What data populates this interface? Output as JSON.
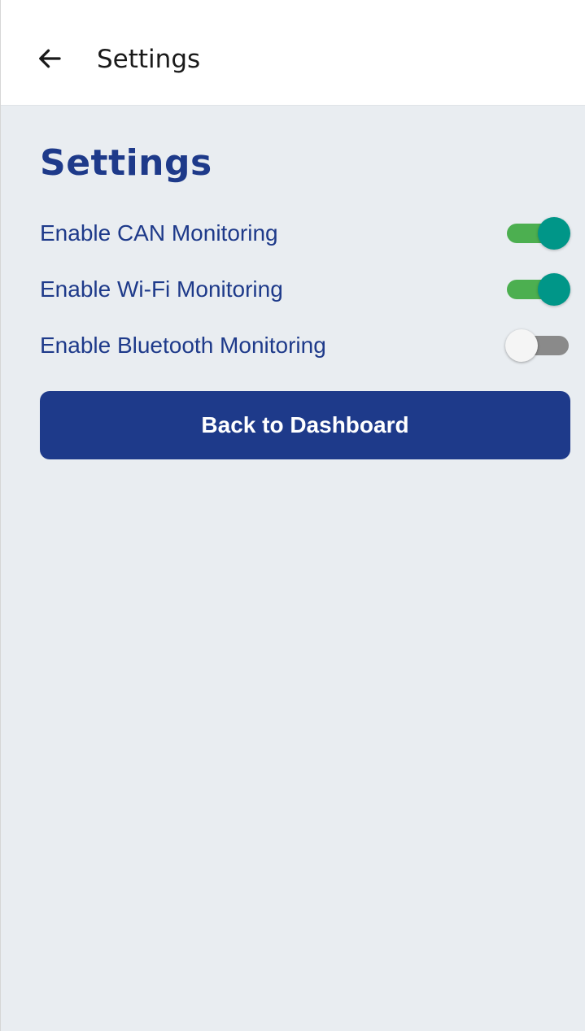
{
  "app_bar": {
    "back_icon": "arrow-left-icon",
    "title": "Settings"
  },
  "main": {
    "title": "Settings",
    "settings": [
      {
        "label": "Enable CAN Monitoring",
        "enabled": true
      },
      {
        "label": "Enable Wi-Fi Monitoring",
        "enabled": true
      },
      {
        "label": "Enable Bluetooth Monitoring",
        "enabled": false
      }
    ],
    "dashboard_button_label": "Back to Dashboard"
  },
  "colors": {
    "primary": "#1e3a8a",
    "switch_track_on": "#4caf50",
    "switch_thumb_on": "#009688",
    "switch_track_off": "#8a8a8a",
    "background": "#e9edf1"
  }
}
